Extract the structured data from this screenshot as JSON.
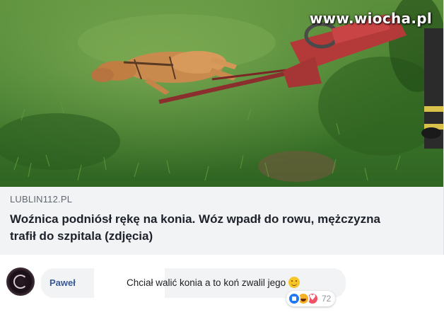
{
  "watermark": "www.wiocha.pl",
  "link_preview": {
    "domain": "LUBLIN112.PL",
    "headline": "Woźnica podniósł rękę na konia. Wóz wpadł do rowu, mężczyzna trafił do szpitala (zdjęcia)"
  },
  "comment": {
    "author": "Paweł",
    "text": "Chciał walić konia a to koń zwalil jego",
    "emoji": "slightly-smiling-face",
    "reactions": {
      "types": [
        "like",
        "haha",
        "love"
      ],
      "count": "72"
    }
  },
  "colors": {
    "author_link": "#385898",
    "card_background": "#f2f3f5",
    "like": "#2078f4",
    "haha": "#f7b125",
    "love": "#f25268"
  }
}
